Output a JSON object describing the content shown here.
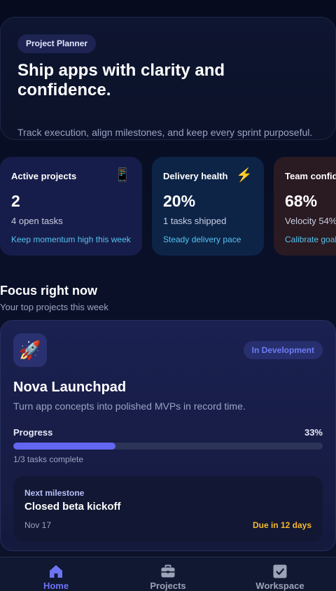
{
  "hero": {
    "chip": "Project Planner",
    "title": "Ship apps with clarity and confidence.",
    "subtitle": "Track execution, align milestones, and keep every sprint purposeful."
  },
  "stats": [
    {
      "title": "Active projects",
      "icon": "mobile-phone-icon",
      "icon_glyph": "📱",
      "value": "2",
      "sub": "4 open tasks",
      "link": "Keep momentum high this week",
      "bg": "#171d4a"
    },
    {
      "title": "Delivery health",
      "icon": "lightning-icon",
      "icon_glyph": "⚡",
      "value": "20%",
      "sub": "1 tasks shipped",
      "link": "Steady delivery pace",
      "bg": "#0d2447"
    },
    {
      "title": "Team confid",
      "value": "68%",
      "sub": "Velocity 54%",
      "link": "Calibrate goal",
      "bg": "#2a1a22"
    }
  ],
  "focus": {
    "title": "Focus right now",
    "subtitle": "Your top projects this week"
  },
  "project": {
    "icon": "rocket-icon",
    "icon_glyph": "🚀",
    "badge": "In Development",
    "name": "Nova Launchpad",
    "description": "Turn app concepts into polished MVPs in record time.",
    "progress_label": "Progress",
    "progress_pct": "33%",
    "progress_value": 0.33,
    "tasks_complete": "1/3 tasks complete",
    "milestone": {
      "label": "Next milestone",
      "title": "Closed beta kickoff",
      "date": "Nov 17",
      "due": "Due in 12 days"
    }
  },
  "tabs": [
    {
      "label": "Home",
      "icon": "home-icon",
      "active": true
    },
    {
      "label": "Projects",
      "icon": "briefcase-icon",
      "active": false
    },
    {
      "label": "Workspace",
      "icon": "checkbox-icon",
      "active": false
    }
  ],
  "colors": {
    "accent": "#6366f1",
    "tab_active": "#6d74f3",
    "tab_inactive": "#9aa3b8",
    "due": "#f5b82e",
    "link": "#55c3f0"
  }
}
